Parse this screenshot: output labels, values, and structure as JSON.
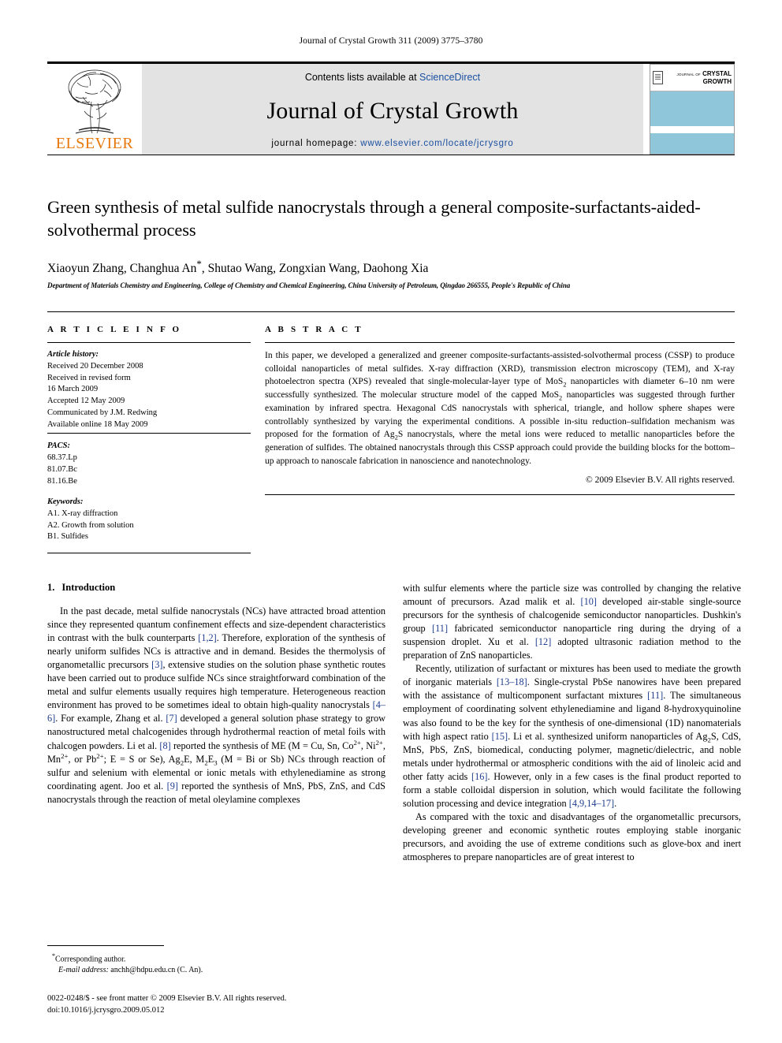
{
  "running_head": "Journal of Crystal Growth 311 (2009) 3775–3780",
  "masthead": {
    "publisher_name": "ELSEVIER",
    "contents_prefix": "Contents lists available at ",
    "contents_link": "ScienceDirect",
    "journal_name": "Journal of Crystal Growth",
    "homepage_label": "journal homepage:",
    "homepage_url": "www.elsevier.com/locate/jcrysgro",
    "cover": {
      "small_journal": "JOURNAL OF",
      "line1": "CRYSTAL",
      "line2": "GROWTH"
    },
    "link_color": "#1a4fa0",
    "brand_color": "#E8780C"
  },
  "title": "Green synthesis of metal sulfide nanocrystals through a general composite-surfactants-aided-solvothermal process",
  "authors": "Xiaoyun Zhang, Changhua An",
  "authors_tail": ", Shutao Wang, Zongxian Wang, Daohong Xia",
  "corresponding_marker": "*",
  "affiliation": "Department of Materials Chemistry and Engineering, College of Chemistry and Chemical Engineering, China University of Petroleum, Qingdao 266555, People's Republic of China",
  "article_info": {
    "heading": "A R T I C L E   I N F O",
    "history_label": "Article history:",
    "history": [
      "Received 20 December 2008",
      "Received in revised form",
      "16 March 2009",
      "Accepted 12 May 2009",
      "Communicated by J.M. Redwing",
      "Available online 18 May 2009"
    ],
    "pacs_label": "PACS:",
    "pacs": [
      "68.37.Lp",
      "81.07.Bc",
      "81.16.Be"
    ],
    "keywords_label": "Keywords:",
    "keywords": [
      "A1. X-ray diffraction",
      "A2. Growth from solution",
      "B1. Sulfides"
    ]
  },
  "abstract": {
    "heading": "A B S T R A C T",
    "part1": "In this paper, we developed a generalized and greener composite-surfactants-assisted-solvothermal process (CSSP) to produce colloidal nanoparticles of metal sulfides. X-ray diffraction (XRD), transmission electron microscopy (TEM), and X-ray photoelectron spectra (XPS) revealed that single-molecular-layer type of MoS",
    "sub1": "2",
    "part2": " nanoparticles with diameter 6–10 nm were successfully synthesized. The molecular structure model of the capped MoS",
    "sub2": "2",
    "part3": " nanoparticles was suggested through further examination by infrared spectra. Hexagonal CdS nanocrystals with spherical, triangle, and hollow sphere shapes were controllably synthesized by varying the experimental conditions. A possible in-situ reduction–sulfidation mechanism was proposed for the formation of Ag",
    "sub3": "2",
    "part4": "S nanocrystals, where the metal ions were reduced to metallic nanoparticles before the generation of sulfides. The obtained nanocrystals through this CSSP approach could provide the building blocks for the bottom–up approach to nanoscale fabrication in nanoscience and nanotechnology.",
    "copyright": "© 2009 Elsevier B.V. All rights reserved."
  },
  "section": {
    "number": "1.",
    "title": "Introduction"
  },
  "left_column": {
    "p1_a": "In the past decade, metal sulfide nanocrystals (NCs) have attracted broad attention since they represented quantum confinement effects and size-dependent characteristics in contrast with the bulk counterparts ",
    "p1_c1": "[1,2]",
    "p1_b": ". Therefore, exploration of the synthesis of nearly uniform sulfides NCs is attractive and in demand. Besides the thermolysis of organometallic precursors ",
    "p1_c2": "[3]",
    "p1_c": ", extensive studies on the solution phase synthetic routes have been carried out to produce sulfide NCs since straightforward combination of the metal and sulfur elements usually requires high temperature. Heterogeneous reaction environment has proved to be sometimes ideal to obtain high-quality nanocrystals ",
    "p1_c3": "[4–6]",
    "p1_d": ". For example, Zhang et al. ",
    "p1_c4": "[7]",
    "p1_e": " developed a general solution phase strategy to grow nanostructured metal chalcogenides through hydrothermal reaction of metal foils with chalcogen powders. Li et al. ",
    "p1_c5": "[8]",
    "p1_f": " reported the synthesis of ME (M = Cu, Sn, Co",
    "sup_co": "2+",
    "p1_g": ", Ni",
    "sup_ni": "2+",
    "p1_h": ", Mn",
    "sup_mn": "2+",
    "p1_i": ", or Pb",
    "sup_pb": "2+",
    "p1_j": "; E = S or Se), Ag",
    "sub_ag": "2",
    "p1_k": "E, M",
    "sub_m": "2",
    "p1_l": "E",
    "sub_e": "3",
    "p1_m": " (M = Bi or Sb) NCs through reaction of sulfur and selenium with elemental or ionic metals with ethylenediamine as strong coordinating agent. Joo et al. ",
    "p1_c6": "[9]",
    "p1_n": " reported the synthesis of MnS, PbS, ZnS, and CdS nanocrystals through the reaction of metal oleylamine complexes"
  },
  "right_column": {
    "p1_a": "with sulfur elements where the particle size was controlled by changing the relative amount of precursors. Azad malik et al. ",
    "p1_c1": "[10]",
    "p1_b": " developed air-stable single-source precursors for the synthesis of chalcogenide semiconductor nanoparticles. Dushkin's group ",
    "p1_c2": "[11]",
    "p1_c": " fabricated semiconductor nanoparticle ring during the drying of a suspension droplet. Xu et al. ",
    "p1_c3": "[12]",
    "p1_d": " adopted ultrasonic radiation method to the preparation of ZnS nanoparticles.",
    "p2_a": "Recently, utilization of surfactant or mixtures has been used to mediate the growth of inorganic materials ",
    "p2_c1": "[13–18]",
    "p2_b": ". Single-crystal PbSe nanowires have been prepared with the assistance of multicomponent surfactant mixtures ",
    "p2_c2": "[11]",
    "p2_c": ". The simultaneous employment of coordinating solvent ethylenediamine and ligand 8-hydroxyquinoline was also found to be the key for the synthesis of one-dimensional (1D) nanomaterials with high aspect ratio ",
    "p2_c3": "[15]",
    "p2_d": ". Li et al. synthesized uniform nanoparticles of Ag",
    "sub_ag": "2",
    "p2_e": "S, CdS, MnS, PbS, ZnS, biomedical, conducting polymer, magnetic/dielectric, and noble metals under hydrothermal or atmospheric conditions with the aid of linoleic acid and other fatty acids ",
    "p2_c4": "[16]",
    "p2_f": ". However, only in a few cases is the final product reported to form a stable colloidal dispersion in solution, which would facilitate the following solution processing and device integration ",
    "p2_c5": "[4,9,14–17]",
    "p2_g": ".",
    "p3": "As compared with the toxic and disadvantages of the organometallic precursors, developing greener and economic synthetic routes employing stable inorganic precursors, and avoiding the use of extreme conditions such as glove-box and inert atmospheres to prepare nanoparticles are of great interest to"
  },
  "footer": {
    "corresponding_marker": "*",
    "corresponding_text": "Corresponding author.",
    "email_label": "E-mail address:",
    "email_value": "anchh@hdpu.edu.cn (C. An).",
    "issn_line": "0022-0248/$ - see front matter © 2009 Elsevier B.V. All rights reserved.",
    "doi_line": "doi:10.1016/j.jcrysgro.2009.05.012"
  }
}
